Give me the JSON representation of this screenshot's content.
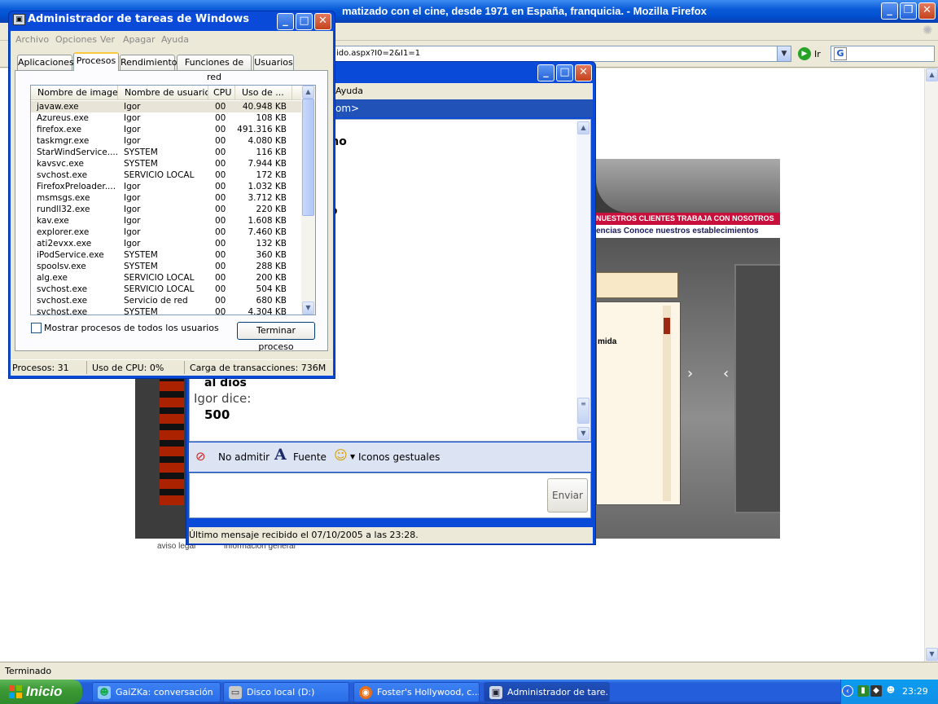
{
  "firefox": {
    "title": "Foster's Hollywood... matizado con el cine, desde 1971 en España, franquicia. - Mozilla Firefox",
    "title_visible": "matizado con el cine, desde 1971 en España, franquicia. - Mozilla Firefox",
    "url": "ido.aspx?I0=2&I1=1",
    "go_label": "Ir",
    "status": "Terminado"
  },
  "website": {
    "red_bar": "NUESTROS CLIENTES   TRABAJA CON NOSOTROS",
    "white_bar": "encias   Conoce nuestros establecimientos",
    "list_fragment": "mida",
    "footer_legal": "aviso legal",
    "footer_info": "información general"
  },
  "msn": {
    "menu_fragment": "Ayuda",
    "address_fragment": "om>",
    "history_fragment_1": "cho",
    "history_fragment_2": "ro",
    "history_fragment_3": "al dios",
    "sender_line": "Igor dice:",
    "last_message": "500",
    "toolbar": {
      "block": "No admitir",
      "font": "Fuente",
      "emoticons": "Iconos gestuales"
    },
    "send_label": "Enviar",
    "status": "Último mensaje recibido el 07/10/2005 a las 23:28."
  },
  "taskmgr": {
    "title": "Administrador de tareas de Windows",
    "menu": [
      "Archivo",
      "Opciones",
      "Ver",
      "Apagar",
      "Ayuda"
    ],
    "tabs": [
      "Aplicaciones",
      "Procesos",
      "Rendimiento",
      "Funciones de red",
      "Usuarios"
    ],
    "active_tab": "Procesos",
    "columns": [
      "Nombre de imagen",
      "Nombre de usuario",
      "CPU",
      "Uso de ..."
    ],
    "processes": [
      {
        "name": "javaw.exe",
        "user": "Igor",
        "cpu": "00",
        "mem": "40.948 KB"
      },
      {
        "name": "Azureus.exe",
        "user": "Igor",
        "cpu": "00",
        "mem": "108 KB"
      },
      {
        "name": "firefox.exe",
        "user": "Igor",
        "cpu": "00",
        "mem": "491.316 KB"
      },
      {
        "name": "taskmgr.exe",
        "user": "Igor",
        "cpu": "00",
        "mem": "4.080 KB"
      },
      {
        "name": "StarWindService....",
        "user": "SYSTEM",
        "cpu": "00",
        "mem": "116 KB"
      },
      {
        "name": "kavsvc.exe",
        "user": "SYSTEM",
        "cpu": "00",
        "mem": "7.944 KB"
      },
      {
        "name": "svchost.exe",
        "user": "SERVICIO LOCAL",
        "cpu": "00",
        "mem": "172 KB"
      },
      {
        "name": "FirefoxPreloader....",
        "user": "Igor",
        "cpu": "00",
        "mem": "1.032 KB"
      },
      {
        "name": "msmsgs.exe",
        "user": "Igor",
        "cpu": "00",
        "mem": "3.712 KB"
      },
      {
        "name": "rundll32.exe",
        "user": "Igor",
        "cpu": "00",
        "mem": "220 KB"
      },
      {
        "name": "kav.exe",
        "user": "Igor",
        "cpu": "00",
        "mem": "1.608 KB"
      },
      {
        "name": "explorer.exe",
        "user": "Igor",
        "cpu": "00",
        "mem": "7.460 KB"
      },
      {
        "name": "ati2evxx.exe",
        "user": "Igor",
        "cpu": "00",
        "mem": "132 KB"
      },
      {
        "name": "iPodService.exe",
        "user": "SYSTEM",
        "cpu": "00",
        "mem": "360 KB"
      },
      {
        "name": "spoolsv.exe",
        "user": "SYSTEM",
        "cpu": "00",
        "mem": "288 KB"
      },
      {
        "name": "alg.exe",
        "user": "SERVICIO LOCAL",
        "cpu": "00",
        "mem": "200 KB"
      },
      {
        "name": "svchost.exe",
        "user": "SERVICIO LOCAL",
        "cpu": "00",
        "mem": "504 KB"
      },
      {
        "name": "svchost.exe",
        "user": "Servicio de red",
        "cpu": "00",
        "mem": "680 KB"
      },
      {
        "name": "svchost.exe",
        "user": "SYSTEM",
        "cpu": "00",
        "mem": "4.304 KB"
      }
    ],
    "show_all_label": "Mostrar procesos de todos los usuarios",
    "end_process_label": "Terminar proceso",
    "status": {
      "processes": "Procesos: 31",
      "cpu": "Uso de CPU: 0%",
      "commit": "Carga de transacciones: 736M"
    }
  },
  "taskbar": {
    "start_label": "Inicio",
    "tasks": [
      {
        "label": "GaiZKa: conversación",
        "icon": "msn-icon"
      },
      {
        "label": "Disco local (D:)",
        "icon": "drive-icon"
      },
      {
        "label": "Foster's Hollywood, c...",
        "icon": "firefox-icon"
      },
      {
        "label": "Administrador de tare...",
        "icon": "taskmgr-icon"
      }
    ],
    "clock": "23:29"
  }
}
